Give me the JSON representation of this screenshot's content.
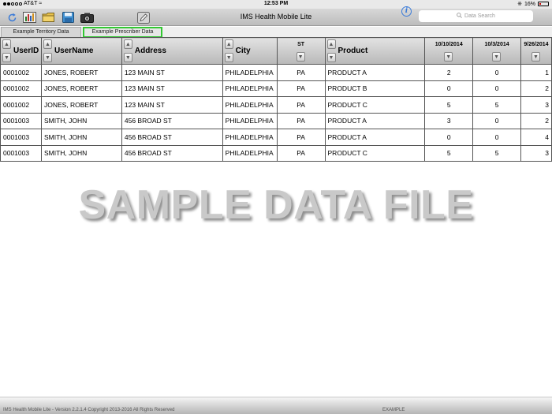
{
  "status_bar": {
    "carrier": "AT&T",
    "time": "12:53 PM",
    "battery": "16%",
    "battery_level": 0.16
  },
  "toolbar": {
    "title": "IMS Health Mobile Lite",
    "icons": [
      "refresh-icon",
      "bar-chart-icon",
      "folder-icon",
      "save-icon",
      "camera-icon",
      "pencil-icon",
      "info-icon"
    ],
    "search_placeholder": "Data Search"
  },
  "tabs": [
    {
      "label": "Example Territory Data",
      "active": false
    },
    {
      "label": "Example Prescriber Data",
      "active": true
    }
  ],
  "table": {
    "columns": [
      {
        "label": "UserID",
        "type": "text"
      },
      {
        "label": "UserName",
        "type": "text"
      },
      {
        "label": "Address",
        "type": "text"
      },
      {
        "label": "City",
        "type": "text"
      },
      {
        "label": "ST",
        "type": "small"
      },
      {
        "label": "Product",
        "type": "text"
      },
      {
        "label": "10/10/2014",
        "type": "date"
      },
      {
        "label": "10/3/2014",
        "type": "date"
      },
      {
        "label": "9/26/2014",
        "type": "date"
      }
    ],
    "rows": [
      [
        "0001002",
        "JONES, ROBERT",
        "123 MAIN ST",
        "PHILADELPHIA",
        "PA",
        "PRODUCT A",
        "2",
        "0",
        "1"
      ],
      [
        "0001002",
        "JONES, ROBERT",
        "123 MAIN ST",
        "PHILADELPHIA",
        "PA",
        "PRODUCT B",
        "0",
        "0",
        "2"
      ],
      [
        "0001002",
        "JONES, ROBERT",
        "123 MAIN ST",
        "PHILADELPHIA",
        "PA",
        "PRODUCT C",
        "5",
        "5",
        "3"
      ],
      [
        "0001003",
        "SMITH, JOHN",
        "456 BROAD ST",
        "PHILADELPHIA",
        "PA",
        "PRODUCT A",
        "3",
        "0",
        "2"
      ],
      [
        "0001003",
        "SMITH, JOHN",
        "456 BROAD ST",
        "PHILADELPHIA",
        "PA",
        "PRODUCT A",
        "0",
        "0",
        "4"
      ],
      [
        "0001003",
        "SMITH, JOHN",
        "456 BROAD ST",
        "PHILADELPHIA",
        "PA",
        "PRODUCT C",
        "5",
        "5",
        "3"
      ]
    ]
  },
  "watermark": "SAMPLE DATA FILE",
  "footer": {
    "version_text": "IMS Health Mobile Lite - Version 2.2.1.4 Copyright 2013-2016 All Rights Reserved",
    "mode": "EXAMPLE"
  },
  "colors": {
    "active_tab_border": "#32c832",
    "accent_blue": "#3b7bd8",
    "battery_low": "#cc0000"
  }
}
